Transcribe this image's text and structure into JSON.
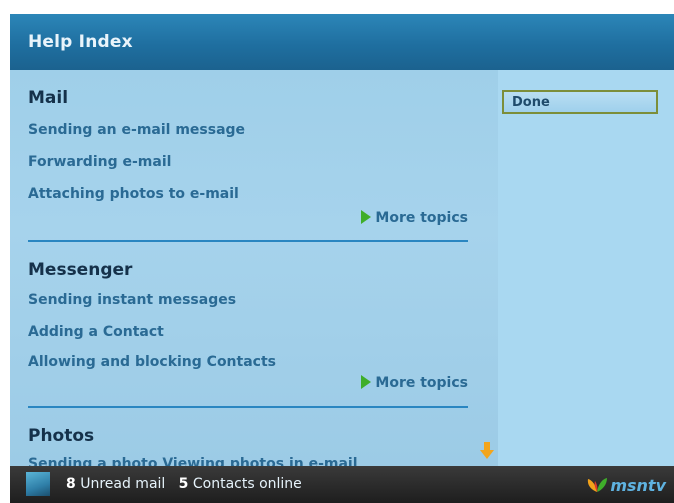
{
  "window": {
    "title": "Help Index"
  },
  "sections": [
    {
      "heading": "Mail",
      "links": [
        "Sending an e-mail message",
        "Forwarding e-mail",
        "Attaching photos to e-mail"
      ],
      "more": "More topics"
    },
    {
      "heading": "Messenger",
      "links": [
        "Sending instant messages",
        "Adding a Contact",
        "Allowing and blocking Contacts"
      ],
      "more": "More topics"
    },
    {
      "heading": "Photos",
      "links": [
        "Sending a photo Viewing photos in e-mail"
      ]
    }
  ],
  "sidebar": {
    "done_label": "Done"
  },
  "status": {
    "unread_count": "8",
    "unread_label": "Unread mail",
    "contacts_count": "5",
    "contacts_label": "Contacts online",
    "logo_text": "msntv"
  },
  "icons": {
    "more_arrow": "green-play-arrow-icon",
    "scroll": "yellow-down-arrow-icon",
    "status": "msntv-home-icon",
    "logo": "msn-butterfly-icon"
  },
  "colors": {
    "title_bar": "#1f6fa0",
    "pane_bg": "#a6d3ec",
    "link": "#2a6a94",
    "heading": "#15314a",
    "divider": "#2a86c1",
    "status_bar": "#1e1e1e",
    "more_arrow": "#3fae2a"
  }
}
